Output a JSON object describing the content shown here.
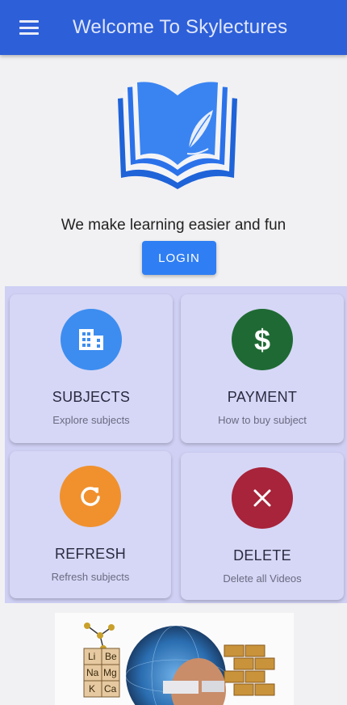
{
  "appbar": {
    "title": "Welcome To Skylectures"
  },
  "hero": {
    "tagline": "We make learning easier and fun",
    "login_label": "LOGIN"
  },
  "cards": [
    {
      "title": "SUBJECTS",
      "subtitle": "Explore subjects",
      "icon": "building-icon",
      "color": "#3d8df0"
    },
    {
      "title": "PAYMENT",
      "subtitle": "How to buy subject",
      "icon": "dollar-icon",
      "color": "#1f6a34"
    },
    {
      "title": "REFRESH",
      "subtitle": "Refresh subjects",
      "icon": "refresh-icon",
      "color": "#f0912e"
    },
    {
      "title": "DELETE",
      "subtitle": "Delete all Videos",
      "icon": "close-icon",
      "color": "#a7243a"
    }
  ],
  "periodic": {
    "row1": [
      "Li",
      "Be"
    ],
    "row2": [
      "Na",
      "Mg"
    ],
    "row3": [
      "K",
      "Ca"
    ]
  },
  "colors": {
    "appbar": "#2d5fd8",
    "login": "#2f7ef3",
    "grid": "#cfd0f4"
  }
}
